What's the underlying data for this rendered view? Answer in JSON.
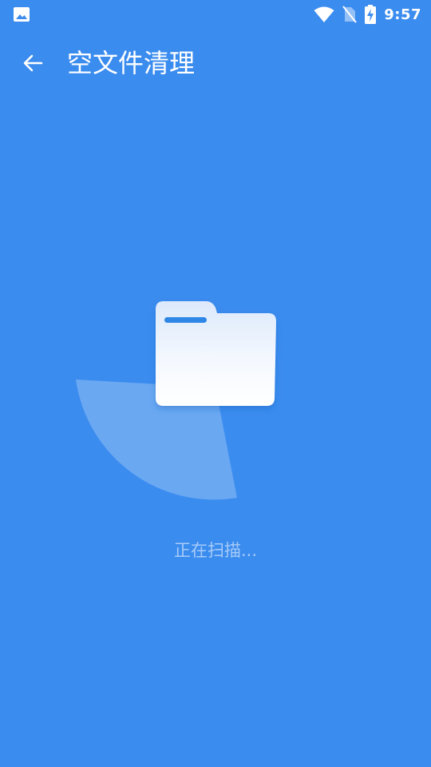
{
  "status_bar": {
    "time": "9:57",
    "icons": [
      "image-notification-icon",
      "wifi-icon",
      "no-sim-icon",
      "battery-charging-icon"
    ]
  },
  "app_bar": {
    "back_icon": "arrow-back-icon",
    "title": "空文件清理"
  },
  "scan": {
    "illustration_icon": "folder-icon",
    "status_text": "正在扫描..."
  },
  "colors": {
    "background": "#3B8CEF",
    "sweep": "#6AA8F2",
    "folder_top": "#DCE9FB",
    "folder_bottom": "#FFFFFF",
    "folder_tab_line": "#2E86E6"
  }
}
